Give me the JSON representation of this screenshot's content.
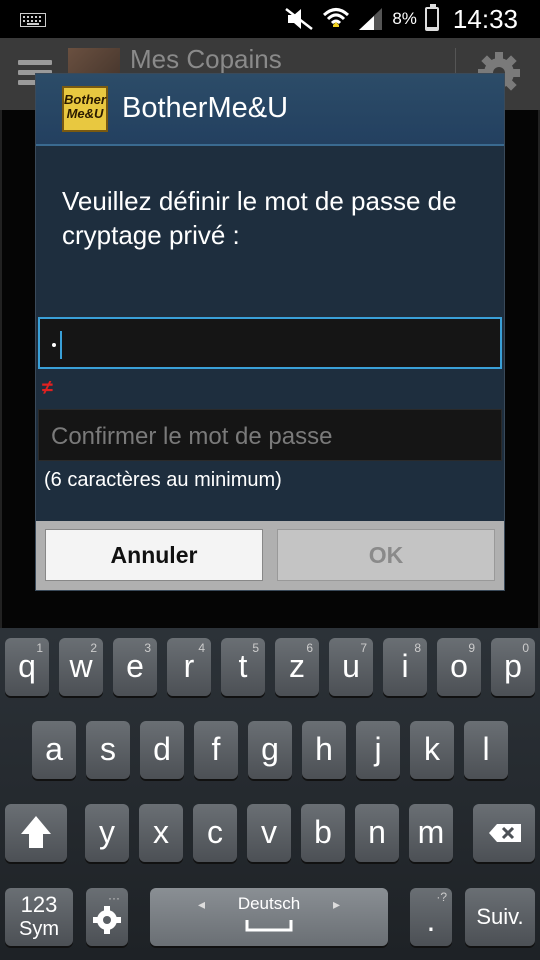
{
  "status_bar": {
    "battery_pct": "8%",
    "time": "14:33"
  },
  "app_bar": {
    "title": "Mes Copains"
  },
  "dialog": {
    "app_name": "BotherMe&U",
    "icon_text_line1": "Bother",
    "icon_text_line2": "Me&U",
    "message": "Veuillez définir le mot de passe de cryptage privé :",
    "password_value": "•",
    "mismatch_symbol": "≠",
    "confirm_placeholder": "Confirmer le mot de passe",
    "hint": "(6 caractères au minimum)",
    "cancel_label": "Annuler",
    "ok_label": "OK"
  },
  "keyboard": {
    "row1": [
      {
        "key": "q",
        "sub": "1"
      },
      {
        "key": "w",
        "sub": "2"
      },
      {
        "key": "e",
        "sub": "3"
      },
      {
        "key": "r",
        "sub": "4"
      },
      {
        "key": "t",
        "sub": "5"
      },
      {
        "key": "z",
        "sub": "6"
      },
      {
        "key": "u",
        "sub": "7"
      },
      {
        "key": "i",
        "sub": "8"
      },
      {
        "key": "o",
        "sub": "9"
      },
      {
        "key": "p",
        "sub": "0"
      }
    ],
    "row2": [
      "a",
      "s",
      "d",
      "f",
      "g",
      "h",
      "j",
      "k",
      "l"
    ],
    "row3": [
      "y",
      "x",
      "c",
      "v",
      "b",
      "n",
      "m"
    ],
    "sym_top": "123",
    "sym_bottom": "Sym",
    "space_label": "Deutsch",
    "period": ".",
    "period_sub": "·?",
    "next_label": "Suiv."
  }
}
